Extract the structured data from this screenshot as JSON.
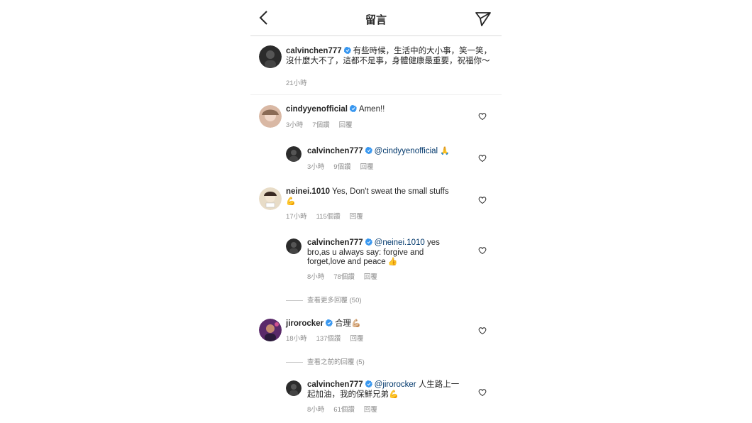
{
  "header": {
    "title": "留言"
  },
  "caption": {
    "username": "calvinchen777",
    "text": "有些時候，生活中的大小事，笑一笑，沒什麼大不了，這都不是事，身體健康最重要，祝福你～",
    "time": "21小時"
  },
  "comments": [
    {
      "username": "cindyyenofficial",
      "text": "Amen!!",
      "time": "3小時",
      "likes": "7個讚",
      "reply": "回覆"
    },
    {
      "username": "calvinchen777",
      "mention": "@cindyyenofficial",
      "text": "🙏",
      "time": "3小時",
      "likes": "9個讚",
      "reply": "回覆"
    },
    {
      "username": "neinei.1010",
      "text": "Yes, Don't sweat the small stuffs",
      "emoji": "💪",
      "time": "17小時",
      "likes": "115個讚",
      "reply": "回覆"
    },
    {
      "username": "calvinchen777",
      "mention": "@neinei.1010",
      "text": "yes bro,as u always say: forgive and forget,love and peace",
      "emoji": "👍",
      "time": "8小時",
      "likes": "78個讚",
      "reply": "回覆"
    },
    {
      "username": "jirorocker",
      "text": "合理",
      "emoji": "💪🏼",
      "time": "18小時",
      "likes": "137個讚",
      "reply": "回覆"
    },
    {
      "username": "calvinchen777",
      "mention": "@jirorocker",
      "text": "人生路上一起加油，我的保鮮兄弟",
      "emoji": "💪",
      "time": "8小時",
      "likes": "61個讚",
      "reply": "回覆"
    }
  ],
  "view_more_replies": "查看更多回覆 (50)",
  "view_previous_replies": "查看之前的回覆 (5)",
  "colors": {
    "verified": "#3897f0",
    "mention": "#00376b",
    "meta": "#8e8e8e"
  },
  "icons": [
    "back-arrow-icon",
    "send-icon",
    "verified-badge-icon",
    "heart-icon"
  ]
}
